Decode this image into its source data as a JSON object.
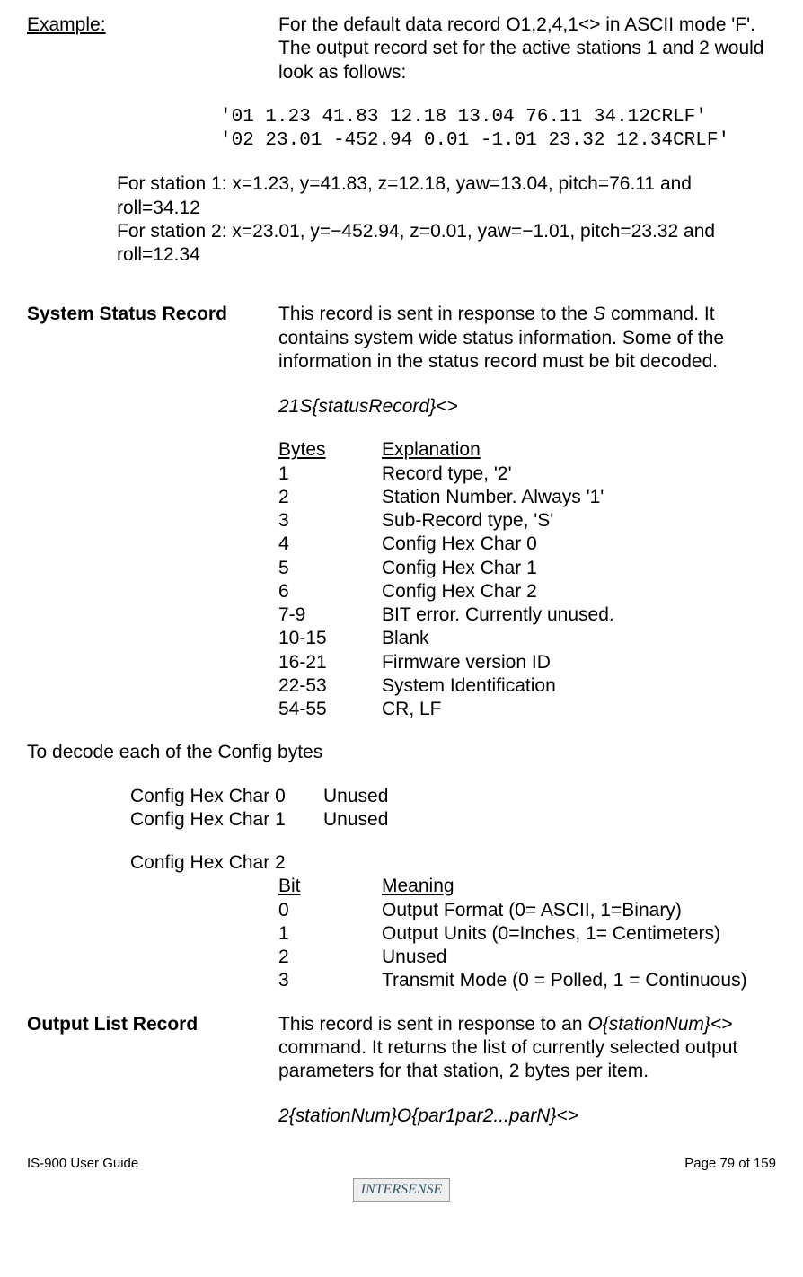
{
  "example": {
    "label": "Example:",
    "intro": "For the default data record O1,2,4,1<> in ASCII mode 'F'. The output record set for the active stations 1 and 2 would look as follows:",
    "mono1": "'01    1.23   41.83   12.18   13.04   76.11   34.12CRLF'",
    "mono2": "'02   23.01 -452.94    0.01   -1.01   23.32   12.34CRLF'",
    "station1": "For station 1: x=1.23,   y=41.83,    z=12.18,  yaw=13.04,  pitch=76.11 and roll=34.12",
    "station2": "For station 2: x=23.01, y=−452.94, z=0.01,   yaw=−1.01,   pitch=23.32 and roll=12.34"
  },
  "systemStatus": {
    "heading": "System Status Record",
    "intro": "This record is sent in response to the ",
    "introItalic": "S",
    "intro2": " command.  It contains system wide status information.  Some of the information in the status record must be bit decoded.",
    "format": "21S{statusRecord}<>",
    "headerBytes": "Bytes",
    "headerExplanation": "Explanation",
    "rows": [
      {
        "b": "1",
        "e": "Record type, '2'"
      },
      {
        "b": "2",
        "e": "Station Number. Always '1'"
      },
      {
        "b": "3",
        "e": "Sub-Record type, 'S'"
      },
      {
        "b": "4",
        "e": "Config Hex Char 0"
      },
      {
        "b": "5",
        "e": "Config Hex Char 1"
      },
      {
        "b": "6",
        "e": "Config Hex Char 2"
      },
      {
        "b": "7-9",
        "e": "BIT error. Currently unused."
      },
      {
        "b": "10-15",
        "e": "Blank"
      },
      {
        "b": "16-21",
        "e": "Firmware version ID"
      },
      {
        "b": "22-53",
        "e": "System Identification"
      },
      {
        "b": "54-55",
        "e": "CR, LF"
      }
    ]
  },
  "decode": {
    "heading": "To decode each of the Config bytes",
    "c0": {
      "label": "Config Hex Char 0",
      "val": "Unused"
    },
    "c1": {
      "label": "Config Hex Char 1",
      "val": "Unused"
    },
    "c2label": "Config Hex Char 2",
    "bitHeader": "Bit",
    "meaningHeader": "Meaning",
    "bits": [
      {
        "b": "0",
        "m": "Output Format (0= ASCII, 1=Binary)"
      },
      {
        "b": "1",
        "m": "Output Units (0=Inches, 1= Centimeters)"
      },
      {
        "b": "2",
        "m": "Unused"
      },
      {
        "b": "3",
        "m": "Transmit Mode (0 = Polled, 1 = Continuous)"
      }
    ]
  },
  "outputList": {
    "heading": "Output List Record",
    "intro1": "This record is sent in response to an ",
    "introItalic": "O{stationNum}<>",
    "intro2": " command. It returns the list of currently selected output parameters for that station, 2 bytes per item.",
    "format": "2{stationNum}O{par1par2...parN}<>"
  },
  "footer": {
    "left": "IS-900 User Guide",
    "right": "Page 79 of 159",
    "logo": "INTERSENSE"
  }
}
